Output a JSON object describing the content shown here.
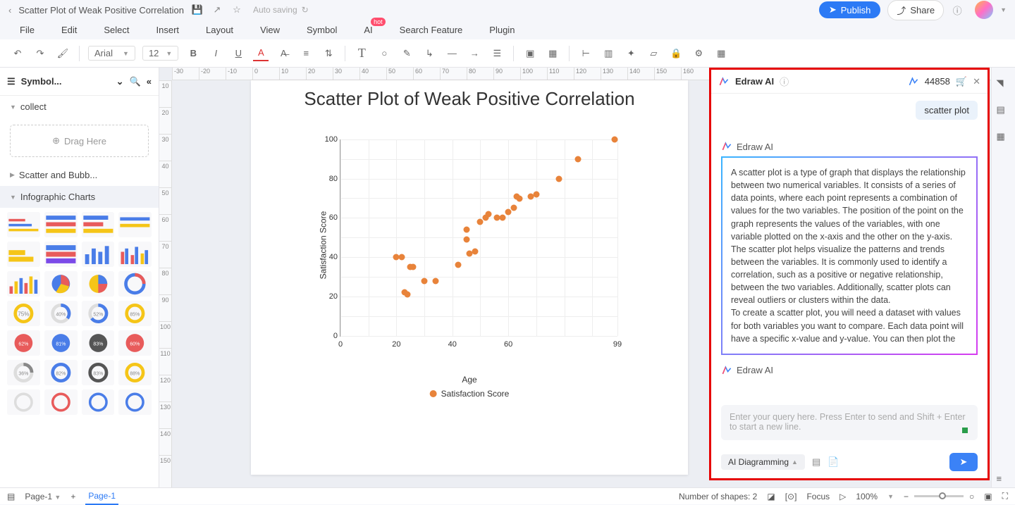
{
  "titlebar": {
    "document_name": "Scatter Plot of Weak Positive Correlation",
    "saving_status": "Auto saving",
    "publish": "Publish",
    "share": "Share"
  },
  "menu": {
    "file": "File",
    "edit": "Edit",
    "select": "Select",
    "insert": "Insert",
    "layout": "Layout",
    "view": "View",
    "symbol": "Symbol",
    "ai": "AI",
    "ai_badge": "hot",
    "search": "Search Feature",
    "plugin": "Plugin"
  },
  "toolbar": {
    "font": "Arial",
    "size": "12"
  },
  "left_panel": {
    "header": "Symbol...",
    "sections": {
      "collect": "collect",
      "scatter": "Scatter and Bubb...",
      "infographic": "Infographic Charts"
    },
    "drag": "Drag Here"
  },
  "ruler_h": [
    "-30",
    "-20",
    "-10",
    "0",
    "10",
    "20",
    "30",
    "40",
    "50",
    "60",
    "70",
    "80",
    "90",
    "100",
    "110",
    "120",
    "130",
    "140",
    "150",
    "160"
  ],
  "ruler_v": [
    "10",
    "20",
    "30",
    "40",
    "50",
    "60",
    "70",
    "80",
    "90",
    "100",
    "110",
    "120",
    "130",
    "140",
    "150"
  ],
  "chart_data": {
    "type": "scatter",
    "title": "Scatter Plot of Weak Positive Correlation",
    "xlabel": "Age",
    "ylabel": "Satisfaction Score",
    "legend": "Satisfaction Score",
    "xlim": [
      0,
      99
    ],
    "ylim": [
      0,
      100
    ],
    "xticks": [
      0,
      20,
      40,
      60,
      99
    ],
    "yticks": [
      0,
      20,
      40,
      60,
      80,
      100
    ],
    "points": [
      {
        "x": 20,
        "y": 40
      },
      {
        "x": 22,
        "y": 40
      },
      {
        "x": 23,
        "y": 22
      },
      {
        "x": 24,
        "y": 21
      },
      {
        "x": 25,
        "y": 35
      },
      {
        "x": 26,
        "y": 35
      },
      {
        "x": 30,
        "y": 28
      },
      {
        "x": 34,
        "y": 28
      },
      {
        "x": 42,
        "y": 36
      },
      {
        "x": 45,
        "y": 54
      },
      {
        "x": 45,
        "y": 49
      },
      {
        "x": 46,
        "y": 42
      },
      {
        "x": 48,
        "y": 43
      },
      {
        "x": 50,
        "y": 58
      },
      {
        "x": 52,
        "y": 60
      },
      {
        "x": 53,
        "y": 62
      },
      {
        "x": 56,
        "y": 60
      },
      {
        "x": 58,
        "y": 60
      },
      {
        "x": 60,
        "y": 63
      },
      {
        "x": 62,
        "y": 65
      },
      {
        "x": 63,
        "y": 71
      },
      {
        "x": 64,
        "y": 70
      },
      {
        "x": 68,
        "y": 71
      },
      {
        "x": 70,
        "y": 72
      },
      {
        "x": 78,
        "y": 80
      },
      {
        "x": 85,
        "y": 90
      },
      {
        "x": 98,
        "y": 100
      }
    ]
  },
  "ai_panel": {
    "title": "Edraw AI",
    "credits": "44858",
    "user_query": "scatter plot",
    "bot_name": "Edraw AI",
    "response_p1": "A scatter plot is a type of graph that displays the relationship between two numerical variables. It consists of a series of data points, where each point represents a combination of values for the two variables. The position of the point on the graph represents the values of the variables, with one variable plotted on the x-axis and the other on the y-axis.",
    "response_p2": "The scatter plot helps visualize the patterns and trends between the variables. It is commonly used to identify a correlation, such as a positive or negative relationship, between the two variables. Additionally, scatter plots can reveal outliers or clusters within the data.",
    "response_p3": "To create a scatter plot, you will need a dataset with values for both variables you want to compare. Each data point will have a specific x-value and y-value. You can then plot the",
    "input_placeholder": "Enter your query here. Press Enter to send and Shift + Enter to start a new line.",
    "mode": "AI Diagramming"
  },
  "bottombar": {
    "page_dropdown": "Page-1",
    "page_tab": "Page-1",
    "shapes": "Number of shapes: 2",
    "focus": "Focus",
    "zoom": "100%"
  }
}
